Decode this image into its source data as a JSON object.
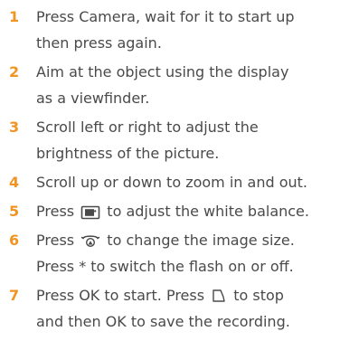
{
  "steps": [
    {
      "num": "1",
      "lines": [
        "Press Camera, wait for it to start up",
        "then press again."
      ]
    },
    {
      "num": "2",
      "lines": [
        "Aim at the object using the display",
        "as a viewfinder."
      ]
    },
    {
      "num": "3",
      "lines": [
        "Scroll left or right to adjust the",
        "brightness of the picture."
      ]
    },
    {
      "num": "4",
      "lines": [
        "Scroll up or down to zoom in and out."
      ]
    },
    {
      "num": "5",
      "line_a": "Press",
      "line_b": "to adjust the white balance.",
      "icon": "white-balance-icon"
    },
    {
      "num": "6",
      "line_a": "Press",
      "line_b": "to change the image size.",
      "icon": "image-size-icon",
      "line2": "Press * to switch the flash on or off."
    },
    {
      "num": "7",
      "line_a": "Press OK to start. Press",
      "line_b": "to stop",
      "icon": "back-icon",
      "line2": "and then OK to save the recording."
    }
  ],
  "colors": {
    "number": "#f29422",
    "text": "#4a4a4a"
  }
}
